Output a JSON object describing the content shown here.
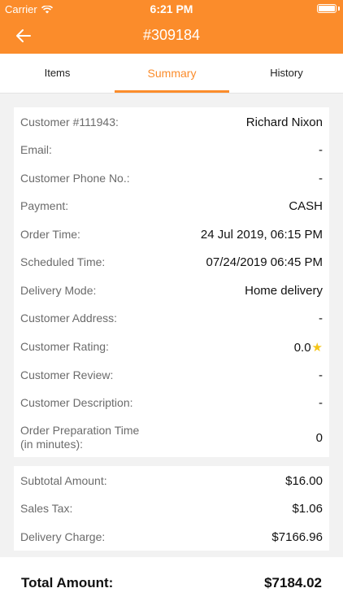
{
  "status_bar": {
    "carrier": "Carrier",
    "time": "6:21 PM",
    "battery_level": 1.0
  },
  "header": {
    "title": "#309184",
    "back_icon": "arrow-left-icon"
  },
  "tabs": [
    {
      "label": "Items",
      "active": false
    },
    {
      "label": "Summary",
      "active": true
    },
    {
      "label": "History",
      "active": false
    }
  ],
  "details": [
    {
      "label": "Customer #111943:",
      "value": "Richard Nixon"
    },
    {
      "label": "Email:",
      "value": "-"
    },
    {
      "label": "Customer Phone No.:",
      "value": "-"
    },
    {
      "label": "Payment:",
      "value": "CASH"
    },
    {
      "label": "Order Time:",
      "value": "24 Jul 2019, 06:15 PM"
    },
    {
      "label": "Scheduled Time:",
      "value": "07/24/2019 06:45 PM"
    },
    {
      "label": "Delivery Mode:",
      "value": "Home delivery"
    },
    {
      "label": "Customer Address:",
      "value": "-"
    },
    {
      "label": "Customer Rating:",
      "value": "0.0",
      "icon": "star-icon"
    },
    {
      "label": "Customer Review:",
      "value": "-"
    },
    {
      "label": "Customer Description:",
      "value": "-"
    },
    {
      "label_line1": "Order Preparation Time",
      "label_line2": "(in minutes):",
      "value": "0"
    }
  ],
  "charges": [
    {
      "label": "Subtotal Amount:",
      "value": "$16.00"
    },
    {
      "label": "Sales Tax:",
      "value": "$1.06"
    },
    {
      "label": "Delivery Charge:",
      "value": "$7166.96"
    }
  ],
  "total": {
    "label": "Total Amount:",
    "value": "$7184.02"
  },
  "colors": {
    "accent": "#fb8c2b",
    "star": "#f5c518",
    "label_gray": "#6b6b6b"
  }
}
